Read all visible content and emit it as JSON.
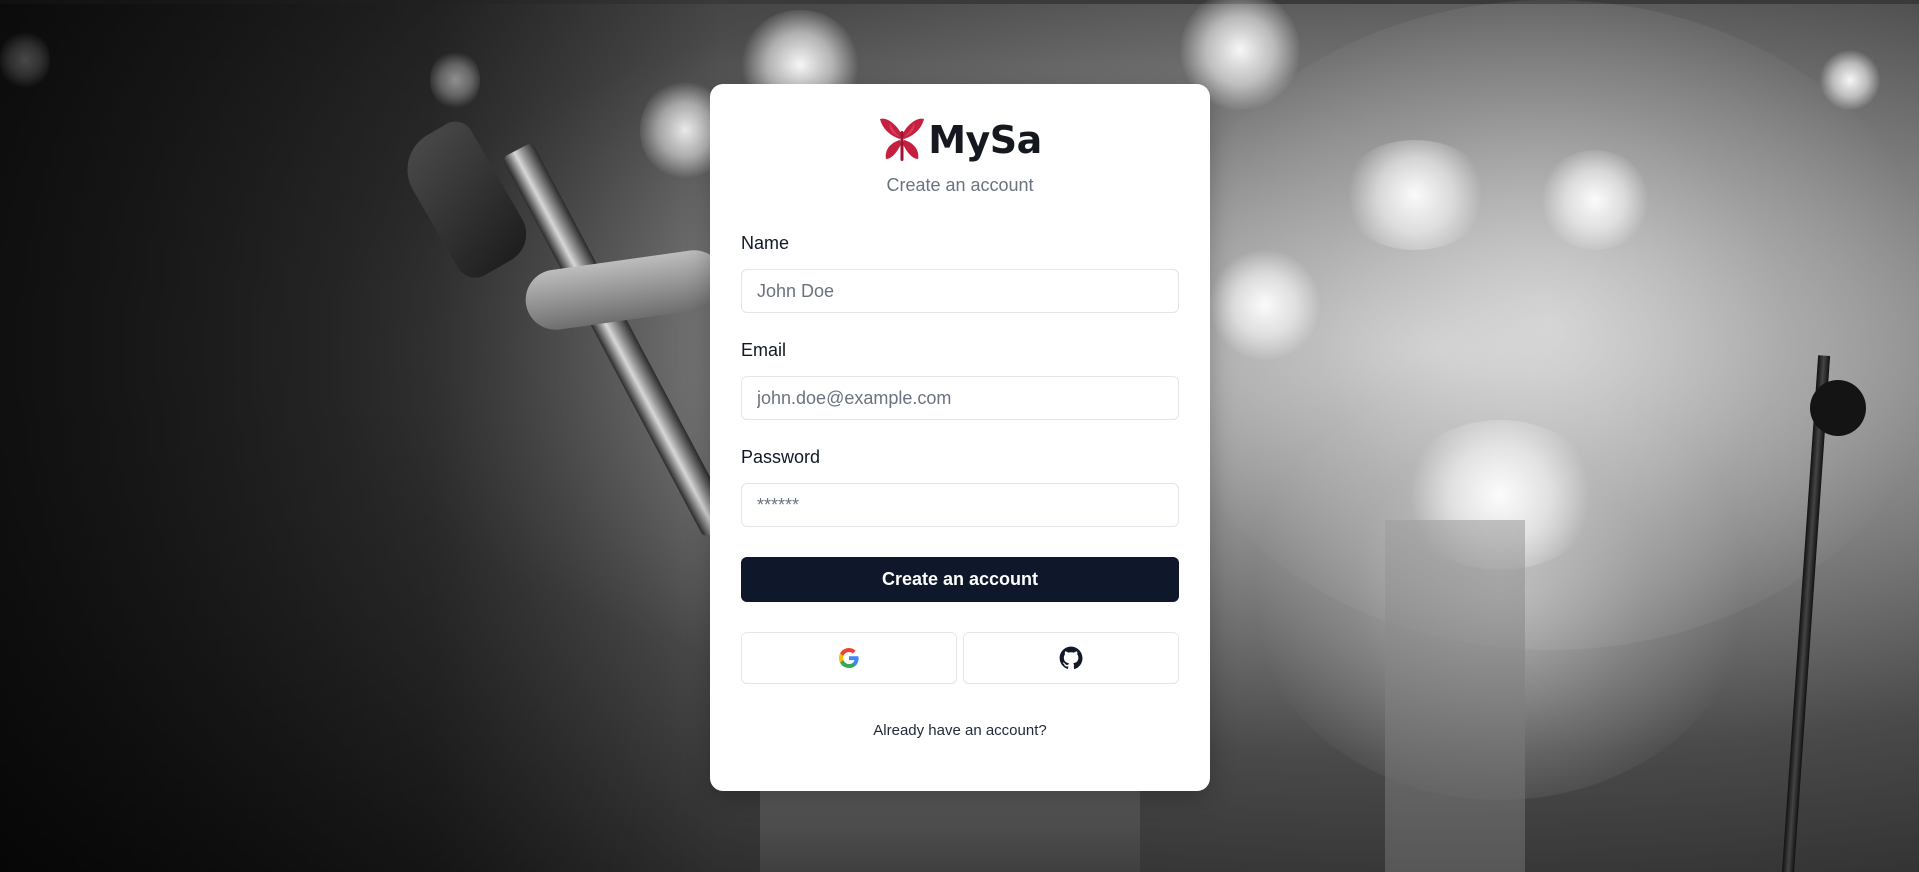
{
  "brand": {
    "name": "MySa",
    "logo_icon": "red-butterfly-logo",
    "logo_color": "#c5203f"
  },
  "subtitle": "Create an account",
  "form": {
    "name_label": "Name",
    "name_placeholder": "John Doe",
    "email_label": "Email",
    "email_placeholder": "john.doe@example.com",
    "password_label": "Password",
    "password_placeholder": "******",
    "submit_label": "Create an account"
  },
  "oauth": [
    {
      "provider": "Google",
      "icon": "google-icon"
    },
    {
      "provider": "GitHub",
      "icon": "github-icon"
    }
  ],
  "footer": {
    "signin_prompt": "Already have an account?"
  },
  "colors": {
    "primary_button": "#0f172a",
    "muted_text": "#6b7280",
    "border": "#e2e5ea"
  },
  "background": {
    "description_icon": "concert-photo-background"
  }
}
